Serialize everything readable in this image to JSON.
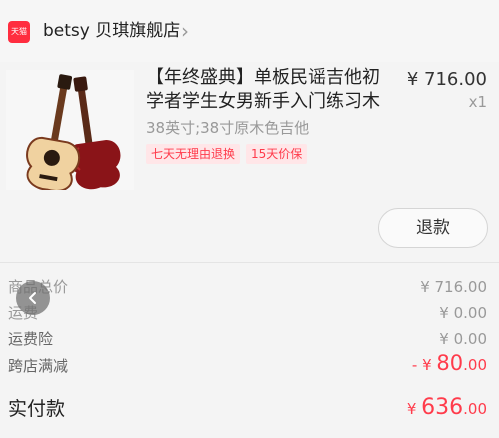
{
  "shop": {
    "badge": "天猫",
    "name": "betsy 贝琪旗舰店",
    "chevron": "›"
  },
  "product": {
    "title": "【年终盛典】单板民谣吉他初学者学生女男新手入门练习木吉...",
    "price": "¥ 716.00",
    "quantity": "x1",
    "spec": "38英寸;38寸原木色吉他",
    "tags": [
      "七天无理由退换",
      "15天价保"
    ]
  },
  "actions": {
    "refund": "退款"
  },
  "summary": {
    "rows": [
      {
        "label": "商品总价",
        "value": "¥ 716.00"
      },
      {
        "label": "运费",
        "value": "¥ 0.00"
      },
      {
        "label": "运费险",
        "value": "¥ 0.00"
      }
    ],
    "discount": {
      "label": "跨店满减",
      "prefix": "- ¥ ",
      "int": "80",
      "dec": ".00"
    },
    "total": {
      "label": "实付款",
      "prefix": "¥ ",
      "int": "636",
      "dec": ".00"
    }
  },
  "icons": {
    "tmall": "tmall-badge-icon",
    "chevron": "chevron-right-icon",
    "back": "back-arrow-icon",
    "product": "acoustic-guitar-image"
  },
  "colors": {
    "accent": "#ff3b4b",
    "tag_bg": "#ffe6e8",
    "tmall": "#ff2d3f"
  }
}
